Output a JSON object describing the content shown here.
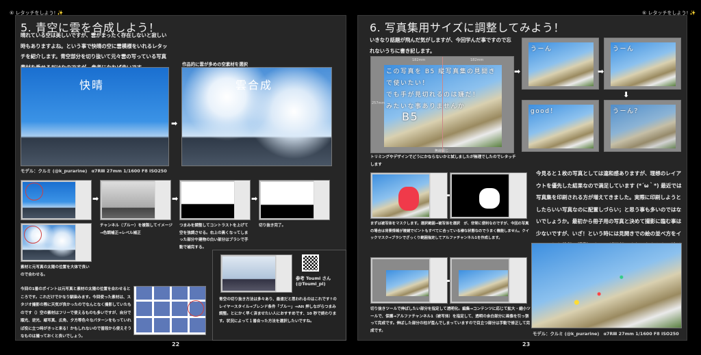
{
  "running_header": "⑥ レタッチをしよう! ✨",
  "left": {
    "title": "5. 青空に雲を合成しよう！",
    "intro": "晴れている空は美しいですが、雲がまったく存在しないと寂しい時もありますよね。という事で快晴の空に雲模様をいれるレタッチを紹介します。青空部分を切り抜いて元々雲の写っている写真素材を乗せるだけなのですが、参考になれば幸いです。",
    "select_caption": "作品的に雲が多めの空素材を選択",
    "photo1_label": "快晴",
    "photo2_label": "雲合成",
    "model_caption": "モデル：クルミ (@k_purarine)　α7RⅢ 27mm 1/1600 F8 ISO250",
    "step_align": "素材と元写真の太陽の位置を大体で良いので合わせる。",
    "step_channel": "チャンネル（ブルー）を複製してイメージ→色調補正→レベル補正",
    "step_contrast": "つまみを調整してコントラストを上げて空を強調させる。右上の黒くなってしまった部分や建物の白い部分はブラシで手動で補完する。",
    "step_done": "切り抜き完了。",
    "point_text": "今回の1番のポイントは元写真と素材の太陽の位置を合わせるところです。これだけでかなり馴染みます。今回使った素材は、スタジオ撮影の際に天気が良かったのでなんとなく撮影していたものです（）空の素材はフリーで使えるものも多いですが、自分で順光、逆光、縦写真、広角、夕方等色々なパターンをもっていれば役に立つ時がきっと来る！かもしれないので普段から使えそうなものは撮っておくと良いでしょう。",
    "ref_label": "参考 Toumi さん",
    "ref_handle": "(@Toumi_pl)",
    "ref_text": "青空の切り抜き方法は多々あり、最速だと思われるのはこれです↑のレイヤースタイル→ブレンド条件「ブルー」→Alt 押しながらつまみ調整。とにかく早く済ませたい人におすすめです、10 秒で終わります。状況によって１番合った方法を選択したいですね。",
    "page_number": "22"
  },
  "right": {
    "title": "6. 写真集用サイズに調整してみよう！",
    "intro": "いきなり話題が飛んだ気がしますが、今回学んだ事ですので忘れないうちに書き記します。",
    "dim_width": "182mm",
    "dim_height": "257mm",
    "binding": "無線綴じ",
    "overlay_lines": [
      "この写真を B5 縦写真集の見開き",
      "で使いたい！",
      "でも手が見切れるのは嫌だ！",
      "みたいな事ありませんか"
    ],
    "overlay_b5": "B5",
    "trim_caption": "トリミングやデザインでどうにかならないかと試しましたが無理でしたのでレタッチします",
    "try_labels": [
      "うーん",
      "うーん",
      "good！",
      "うーん？"
    ],
    "mask_caption": "まずは被写体をマスクします。選択範囲→被写体を選択　が、非常に便利なのですが、今回の写真の場合は背景情報が複雑でピントもすべてに合っている様な状態なのでうまく機能しません。クイックマスク→ブラシでざっくり範囲指定してアルファチャンネル1を作成します。",
    "crop_caption": "切り抜きツールで伸ばしたい部分を指定して透明化。編集→コンテンツに応じて拡大・縮小ツールで、保護→アルファチャンネル1（被写体）を指定して、透明の余白部分に画像を引っ張って完成です。伸ばした部分の柱が歪んでしまっていますので目立つ部分は手動で修正して完成です。",
    "essay": "今見ると１枚の写真としては違和感ありますが、理想のレイアウトを優先した結果なので満足しています (*´ω｀*) 最近では写真集を印刷される方が増えてきました。実際に印刷しようとしたらいい写真なのに配置しづらい；と思う事も多いのではないでしょうか。最初から冊子用の写真と決めて撮影に臨む事は少ないですが、いざ！という時には見開きでの絵の並べ方をイメージした状態で撮影できるのが理想ですね。わからない時はとりあえず縦横広めにとっておきます v",
    "model_caption": "モデル：クルミ (@k_purarine)　α7RⅢ 27mm 1/1600 F8 ISO250",
    "page_number": "23"
  }
}
